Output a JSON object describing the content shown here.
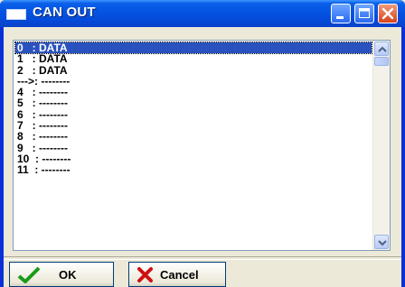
{
  "window": {
    "title": "CAN OUT",
    "icon": "window-app-icon",
    "controls": [
      "minimize-icon",
      "maximize-icon",
      "close-icon"
    ]
  },
  "list": {
    "selected_index": 0,
    "items": [
      "0   : DATA",
      "1   : DATA",
      "2   : DATA",
      "--->: --------",
      "4   : --------",
      "5   : --------",
      "6   : --------",
      "7   : --------",
      "8   : --------",
      "9   : --------",
      "10  : --------",
      "11  : --------"
    ]
  },
  "buttons": {
    "ok_label": "OK",
    "cancel_label": "Cancel"
  },
  "colors": {
    "titlebar": "#0553e3",
    "selection": "#2a52be",
    "ok_check": "#1a9a1a",
    "cancel_x": "#d01010"
  }
}
